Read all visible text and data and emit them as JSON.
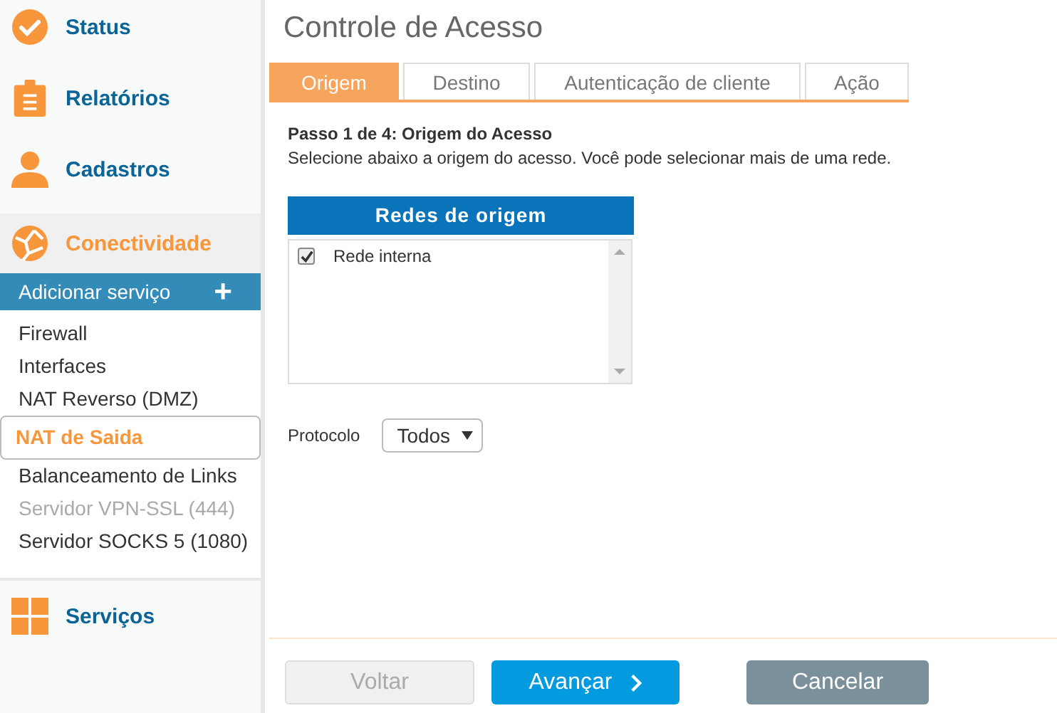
{
  "sidebar": {
    "sections": [
      {
        "kind": "check",
        "label": "Status",
        "selected": false
      },
      {
        "kind": "clipboard",
        "label": "Relatórios",
        "selected": false
      },
      {
        "kind": "person",
        "label": "Cadastros",
        "selected": false
      },
      {
        "kind": "globe",
        "label": "Conectividade",
        "selected": true,
        "add_label": "Adicionar serviço",
        "add_icon": "+",
        "items": [
          {
            "label": "Firewall",
            "selected": false,
            "disabled": false
          },
          {
            "label": "Interfaces",
            "selected": false,
            "disabled": false
          },
          {
            "label": "NAT Reverso (DMZ)",
            "selected": false,
            "disabled": false
          },
          {
            "label": "NAT de Saida",
            "selected": true,
            "disabled": false
          },
          {
            "label": "Balanceamento de Links",
            "selected": false,
            "disabled": false
          },
          {
            "label": "Servidor VPN-SSL (444)",
            "selected": false,
            "disabled": true
          },
          {
            "label": "Servidor SOCKS 5 (1080)",
            "selected": false,
            "disabled": false
          }
        ]
      },
      {
        "kind": "grid",
        "label": "Serviços",
        "selected": false
      }
    ]
  },
  "page": {
    "title": "Controle de Acesso"
  },
  "tabs": [
    {
      "label": "Origem",
      "selected": true
    },
    {
      "label": "Destino",
      "selected": false
    },
    {
      "label": "Autenticação de cliente",
      "selected": false
    },
    {
      "label": "Ação",
      "selected": false
    }
  ],
  "step": {
    "heading": "Passo 1 de 4: Origem do Acesso",
    "description": "Selecione abaixo a origem do acesso. Você pode selecionar mais de uma rede."
  },
  "networks": {
    "header": "Redes de origem",
    "items": [
      {
        "label": "Rede interna",
        "checked": true
      }
    ]
  },
  "protocol": {
    "label": "Protocolo",
    "value": "Todos"
  },
  "buttons": [
    {
      "kind": "back",
      "label": "Voltar",
      "disabled": true
    },
    {
      "kind": "next",
      "label": "Avançar",
      "disabled": false
    },
    {
      "kind": "cancel",
      "label": "Cancelar",
      "disabled": false
    }
  ]
}
